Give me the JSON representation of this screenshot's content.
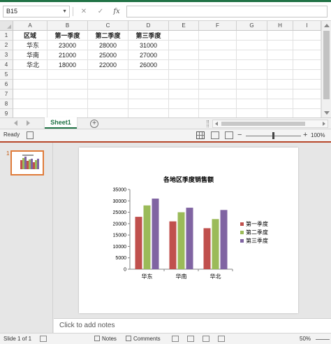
{
  "excel": {
    "name_box": "B15",
    "formula_value": "",
    "fx_label": "fx",
    "cancel_glyph": "✕",
    "enter_glyph": "✓",
    "columns": [
      "A",
      "B",
      "C",
      "D",
      "E",
      "F",
      "G",
      "H",
      "I"
    ],
    "rows": [
      "1",
      "2",
      "3",
      "4",
      "5",
      "6",
      "7",
      "8",
      "9"
    ],
    "table": {
      "header": [
        "区域",
        "第一季度",
        "第二季度",
        "第三季度"
      ],
      "data": [
        [
          "华东",
          "23000",
          "28000",
          "31000"
        ],
        [
          "华南",
          "21000",
          "25000",
          "27000"
        ],
        [
          "华北",
          "18000",
          "22000",
          "26000"
        ]
      ]
    },
    "sheet_tab": "Sheet1",
    "add_sheet": "+",
    "status": "Ready",
    "zoom_minus": "−",
    "zoom_plus": "+",
    "zoom": "100%"
  },
  "ppt": {
    "slide_number": "1",
    "notes_placeholder": "Click to add notes",
    "slide_status": "Slide 1 of 1",
    "notes_button": "Notes",
    "comments_button": "Comments",
    "zoom": "50%"
  },
  "colors": {
    "excel_green": "#217346",
    "ppt_orange": "#e07b39",
    "series": [
      "#c0504d",
      "#9bbb59",
      "#8064a2"
    ]
  },
  "chart_data": {
    "type": "bar",
    "title": "各地区季度销售额",
    "categories": [
      "华东",
      "华南",
      "华北"
    ],
    "series": [
      {
        "name": "第一季度",
        "values": [
          23000,
          21000,
          18000
        ]
      },
      {
        "name": "第二季度",
        "values": [
          28000,
          25000,
          22000
        ]
      },
      {
        "name": "第三季度",
        "values": [
          31000,
          27000,
          26000
        ]
      }
    ],
    "y_ticks": [
      "0",
      "5000",
      "10000",
      "15000",
      "20000",
      "25000",
      "30000",
      "35000"
    ],
    "ylim": [
      0,
      35000
    ],
    "legend_position": "right",
    "grid": false
  }
}
